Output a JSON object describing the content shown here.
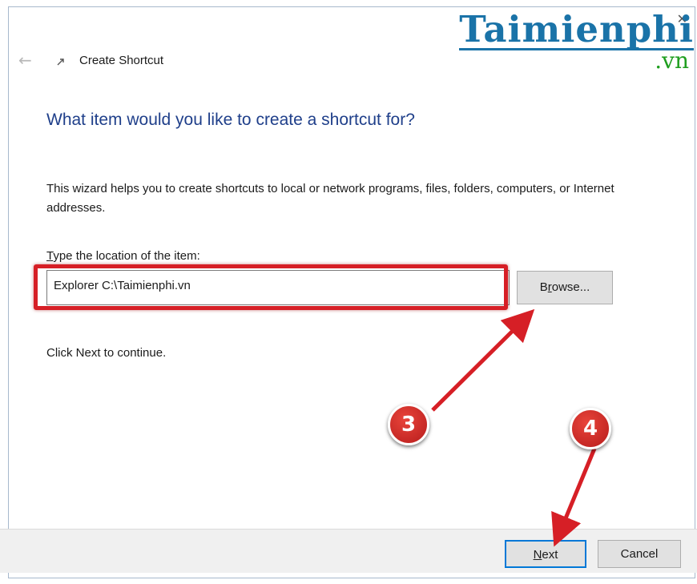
{
  "titlebar": {
    "back_icon": "back-arrow-icon",
    "app_icon": "shortcut-icon",
    "title": "Create Shortcut",
    "close_icon": "close-icon"
  },
  "watermark": {
    "main": "Taimienphi",
    "sub": ".vn"
  },
  "wizard": {
    "heading": "What item would you like to create a shortcut for?",
    "description": "This wizard helps you to create shortcuts to local or network programs, files, folders, computers, or Internet addresses.",
    "location_label": "Type the location of the item:",
    "location_value": "Explorer C:\\Taimienphi.vn",
    "browse_label": "Browse...",
    "hint": "Click Next to continue."
  },
  "footer": {
    "next_label": "Next",
    "cancel_label": "Cancel"
  },
  "annotations": {
    "step3": "3",
    "step4": "4",
    "highlight_color": "#d61f26"
  },
  "colors": {
    "heading": "#1f3f8a",
    "accent": "#0078d7",
    "footer_bg": "#f0f0f0"
  }
}
